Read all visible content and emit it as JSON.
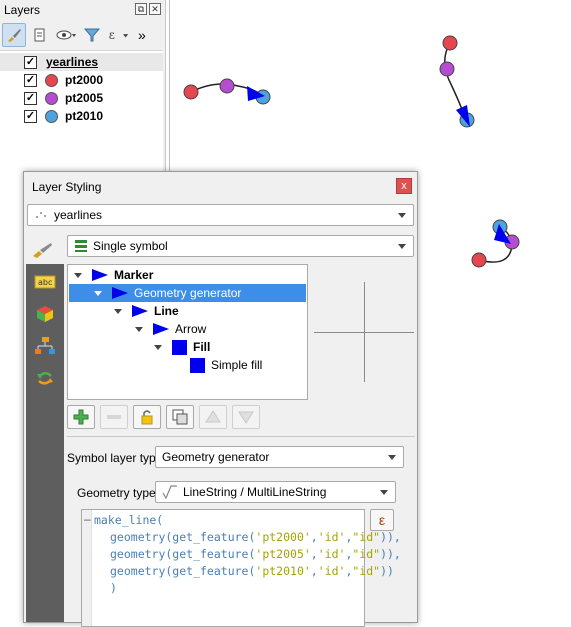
{
  "layers_panel": {
    "title": "Layers",
    "float_btn": "⧉",
    "close_btn": "✕",
    "more": "»",
    "layers": [
      {
        "name": "yearlines",
        "checked": "✓",
        "color": "#ffffff",
        "selected": true
      },
      {
        "name": "pt2000",
        "checked": "✓",
        "color": "#e5474f"
      },
      {
        "name": "pt2005",
        "checked": "✓",
        "color": "#b54cd1"
      },
      {
        "name": "pt2010",
        "checked": "✓",
        "color": "#4ea3df"
      }
    ]
  },
  "styling": {
    "title": "Layer Styling",
    "close": "x",
    "layer_combo": "yearlines",
    "renderer_combo": "Single symbol",
    "tree": {
      "marker": "Marker",
      "geometry_generator": "Geometry generator",
      "line": "Line",
      "arrow": "Arrow",
      "fill": "Fill",
      "simple_fill": "Simple fill"
    },
    "symbol_layer_type_label": "Symbol layer type",
    "symbol_layer_type_value": "Geometry generator",
    "geometry_type_label": "Geometry type",
    "geometry_type_value": "LineString / MultiLineString",
    "expression_icon": "ε",
    "expression": {
      "l1": "make_line(",
      "l2a": "geometry(get_feature(",
      "l2b": "'pt2000'",
      "l2c": ",",
      "l2d": "'id'",
      "l2e": ",",
      "l2f": "\"id\"",
      "l2g": ")),",
      "l3a": "geometry(get_feature(",
      "l3b": "'pt2005'",
      "l3c": ",",
      "l3d": "'id'",
      "l3e": ",",
      "l3f": "\"id\"",
      "l3g": ")),",
      "l4a": "geometry(get_feature(",
      "l4b": "'pt2010'",
      "l4c": ",",
      "l4d": "'id'",
      "l4e": ",",
      "l4f": "\"id\"",
      "l4g": "))",
      "l5": ")"
    }
  },
  "colors": {
    "pt2000": "#e5474f",
    "pt2005": "#b54cd1",
    "pt2010": "#4ea3df",
    "arrow": "#0000ee",
    "selection": "#3d8ee8"
  }
}
